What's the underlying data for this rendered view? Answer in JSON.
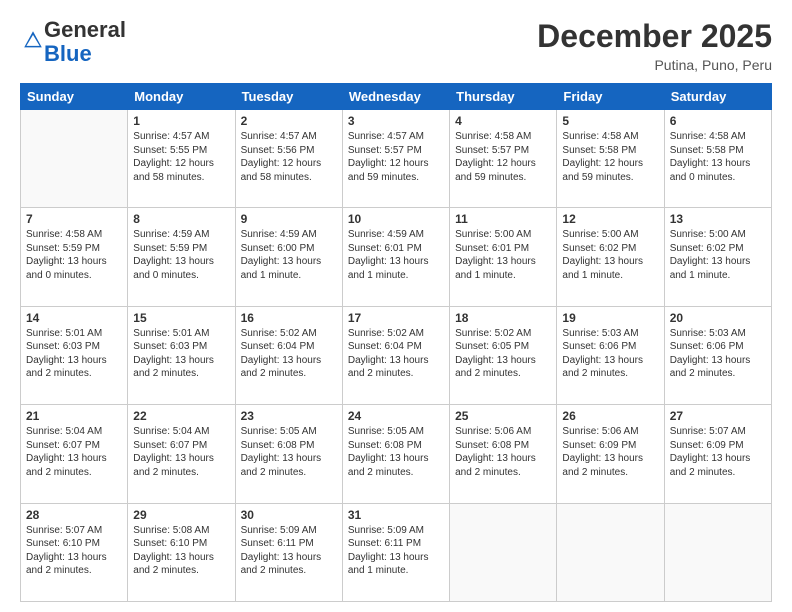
{
  "logo": {
    "general": "General",
    "blue": "Blue"
  },
  "header": {
    "title": "December 2025",
    "location": "Putina, Puno, Peru"
  },
  "days_of_week": [
    "Sunday",
    "Monday",
    "Tuesday",
    "Wednesday",
    "Thursday",
    "Friday",
    "Saturday"
  ],
  "weeks": [
    [
      {
        "day": "",
        "info": ""
      },
      {
        "day": "1",
        "info": "Sunrise: 4:57 AM\nSunset: 5:55 PM\nDaylight: 12 hours\nand 58 minutes."
      },
      {
        "day": "2",
        "info": "Sunrise: 4:57 AM\nSunset: 5:56 PM\nDaylight: 12 hours\nand 58 minutes."
      },
      {
        "day": "3",
        "info": "Sunrise: 4:57 AM\nSunset: 5:57 PM\nDaylight: 12 hours\nand 59 minutes."
      },
      {
        "day": "4",
        "info": "Sunrise: 4:58 AM\nSunset: 5:57 PM\nDaylight: 12 hours\nand 59 minutes."
      },
      {
        "day": "5",
        "info": "Sunrise: 4:58 AM\nSunset: 5:58 PM\nDaylight: 12 hours\nand 59 minutes."
      },
      {
        "day": "6",
        "info": "Sunrise: 4:58 AM\nSunset: 5:58 PM\nDaylight: 13 hours\nand 0 minutes."
      }
    ],
    [
      {
        "day": "7",
        "info": "Sunrise: 4:58 AM\nSunset: 5:59 PM\nDaylight: 13 hours\nand 0 minutes."
      },
      {
        "day": "8",
        "info": "Sunrise: 4:59 AM\nSunset: 5:59 PM\nDaylight: 13 hours\nand 0 minutes."
      },
      {
        "day": "9",
        "info": "Sunrise: 4:59 AM\nSunset: 6:00 PM\nDaylight: 13 hours\nand 1 minute."
      },
      {
        "day": "10",
        "info": "Sunrise: 4:59 AM\nSunset: 6:01 PM\nDaylight: 13 hours\nand 1 minute."
      },
      {
        "day": "11",
        "info": "Sunrise: 5:00 AM\nSunset: 6:01 PM\nDaylight: 13 hours\nand 1 minute."
      },
      {
        "day": "12",
        "info": "Sunrise: 5:00 AM\nSunset: 6:02 PM\nDaylight: 13 hours\nand 1 minute."
      },
      {
        "day": "13",
        "info": "Sunrise: 5:00 AM\nSunset: 6:02 PM\nDaylight: 13 hours\nand 1 minute."
      }
    ],
    [
      {
        "day": "14",
        "info": "Sunrise: 5:01 AM\nSunset: 6:03 PM\nDaylight: 13 hours\nand 2 minutes."
      },
      {
        "day": "15",
        "info": "Sunrise: 5:01 AM\nSunset: 6:03 PM\nDaylight: 13 hours\nand 2 minutes."
      },
      {
        "day": "16",
        "info": "Sunrise: 5:02 AM\nSunset: 6:04 PM\nDaylight: 13 hours\nand 2 minutes."
      },
      {
        "day": "17",
        "info": "Sunrise: 5:02 AM\nSunset: 6:04 PM\nDaylight: 13 hours\nand 2 minutes."
      },
      {
        "day": "18",
        "info": "Sunrise: 5:02 AM\nSunset: 6:05 PM\nDaylight: 13 hours\nand 2 minutes."
      },
      {
        "day": "19",
        "info": "Sunrise: 5:03 AM\nSunset: 6:06 PM\nDaylight: 13 hours\nand 2 minutes."
      },
      {
        "day": "20",
        "info": "Sunrise: 5:03 AM\nSunset: 6:06 PM\nDaylight: 13 hours\nand 2 minutes."
      }
    ],
    [
      {
        "day": "21",
        "info": "Sunrise: 5:04 AM\nSunset: 6:07 PM\nDaylight: 13 hours\nand 2 minutes."
      },
      {
        "day": "22",
        "info": "Sunrise: 5:04 AM\nSunset: 6:07 PM\nDaylight: 13 hours\nand 2 minutes."
      },
      {
        "day": "23",
        "info": "Sunrise: 5:05 AM\nSunset: 6:08 PM\nDaylight: 13 hours\nand 2 minutes."
      },
      {
        "day": "24",
        "info": "Sunrise: 5:05 AM\nSunset: 6:08 PM\nDaylight: 13 hours\nand 2 minutes."
      },
      {
        "day": "25",
        "info": "Sunrise: 5:06 AM\nSunset: 6:08 PM\nDaylight: 13 hours\nand 2 minutes."
      },
      {
        "day": "26",
        "info": "Sunrise: 5:06 AM\nSunset: 6:09 PM\nDaylight: 13 hours\nand 2 minutes."
      },
      {
        "day": "27",
        "info": "Sunrise: 5:07 AM\nSunset: 6:09 PM\nDaylight: 13 hours\nand 2 minutes."
      }
    ],
    [
      {
        "day": "28",
        "info": "Sunrise: 5:07 AM\nSunset: 6:10 PM\nDaylight: 13 hours\nand 2 minutes."
      },
      {
        "day": "29",
        "info": "Sunrise: 5:08 AM\nSunset: 6:10 PM\nDaylight: 13 hours\nand 2 minutes."
      },
      {
        "day": "30",
        "info": "Sunrise: 5:09 AM\nSunset: 6:11 PM\nDaylight: 13 hours\nand 2 minutes."
      },
      {
        "day": "31",
        "info": "Sunrise: 5:09 AM\nSunset: 6:11 PM\nDaylight: 13 hours\nand 1 minute."
      },
      {
        "day": "",
        "info": ""
      },
      {
        "day": "",
        "info": ""
      },
      {
        "day": "",
        "info": ""
      }
    ]
  ]
}
